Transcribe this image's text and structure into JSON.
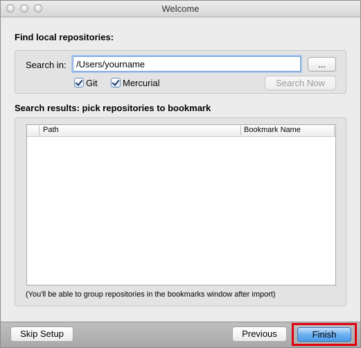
{
  "window": {
    "title": "Welcome"
  },
  "find_section": {
    "heading": "Find local repositories:",
    "search_label": "Search in:",
    "search_value": "/Users/yourname",
    "browse_label": "...",
    "git_label": "Git",
    "git_checked": true,
    "mercurial_label": "Mercurial",
    "mercurial_checked": true,
    "search_now_label": "Search Now"
  },
  "results_section": {
    "heading": "Search results: pick repositories to bookmark",
    "columns": [
      "Path",
      "Bookmark Name"
    ],
    "rows": [],
    "note": "(You'll be able to group repositories in the bookmarks window after import)"
  },
  "footer": {
    "skip_label": "Skip Setup",
    "previous_label": "Previous",
    "finish_label": "Finish"
  },
  "colors": {
    "highlight": "#e0000f",
    "primary_button": "#4b9bea",
    "focus_ring": "#a8c6ee"
  }
}
